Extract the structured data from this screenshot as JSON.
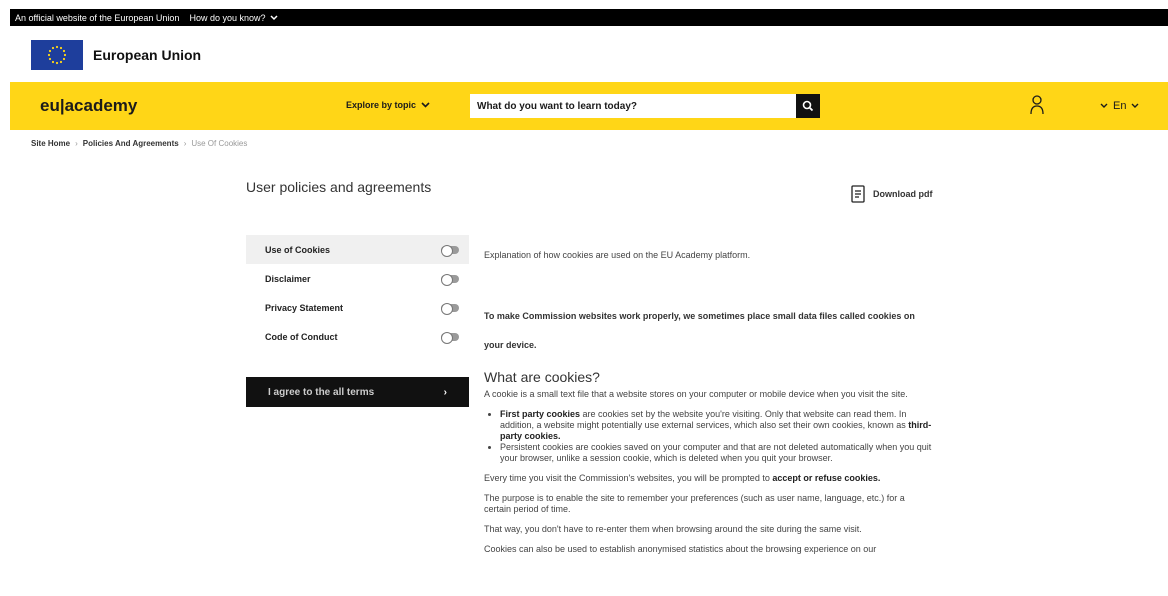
{
  "topbar": {
    "official_text": "An official website of the European Union",
    "how_text": "How do you know?"
  },
  "eu_header": {
    "name": "European Union"
  },
  "nav": {
    "logo": "eu|academy",
    "explore": "Explore by topic",
    "search_placeholder": "What do you want to learn today?",
    "lang": "En"
  },
  "breadcrumb": {
    "home": "Site Home",
    "policies": "Policies And Agreements",
    "current": "Use Of Cookies"
  },
  "page": {
    "title": "User policies and agreements",
    "download": "Download pdf"
  },
  "sidebar": {
    "items": [
      {
        "label": "Use of Cookies"
      },
      {
        "label": "Disclaimer"
      },
      {
        "label": "Privacy Statement"
      },
      {
        "label": "Code of Conduct"
      }
    ],
    "agree": "I agree to the all terms"
  },
  "content": {
    "intro": "Explanation of how cookies are used on the EU Academy platform.",
    "bold_intro": "To make Commission websites work properly, we sometimes place small data files called cookies on your device.",
    "heading": "What are cookies?",
    "para1": "A cookie is a small text file that a website stores on your computer or mobile device when you visit the site.",
    "bullet1_bold": "First party cookies",
    "bullet1_text": " are cookies set by the website you're visiting. Only that website can read them. In addition, a website might potentially use external services, which also set their own cookies, known as ",
    "bullet1_bold2": "third-party cookies.",
    "bullet2": "Persistent cookies are cookies saved on your computer and that are not deleted automatically when you quit your browser, unlike a session cookie, which is deleted when you quit your browser.",
    "para2_text": "Every time you visit the Commission's websites, you will be prompted to ",
    "para2_bold": "accept or refuse cookies.",
    "para3": "The purpose is to enable the site to remember your preferences (such as user name, language, etc.) for a certain period of time.",
    "para4": "That way, you don't have to re-enter them when browsing around the site during the same visit.",
    "para5": "Cookies can also be used to establish anonymised statistics about the browsing experience on our"
  },
  "colors": {
    "yellow": "#ffd617",
    "eu_blue": "#1e3e9c",
    "black": "#111111"
  }
}
